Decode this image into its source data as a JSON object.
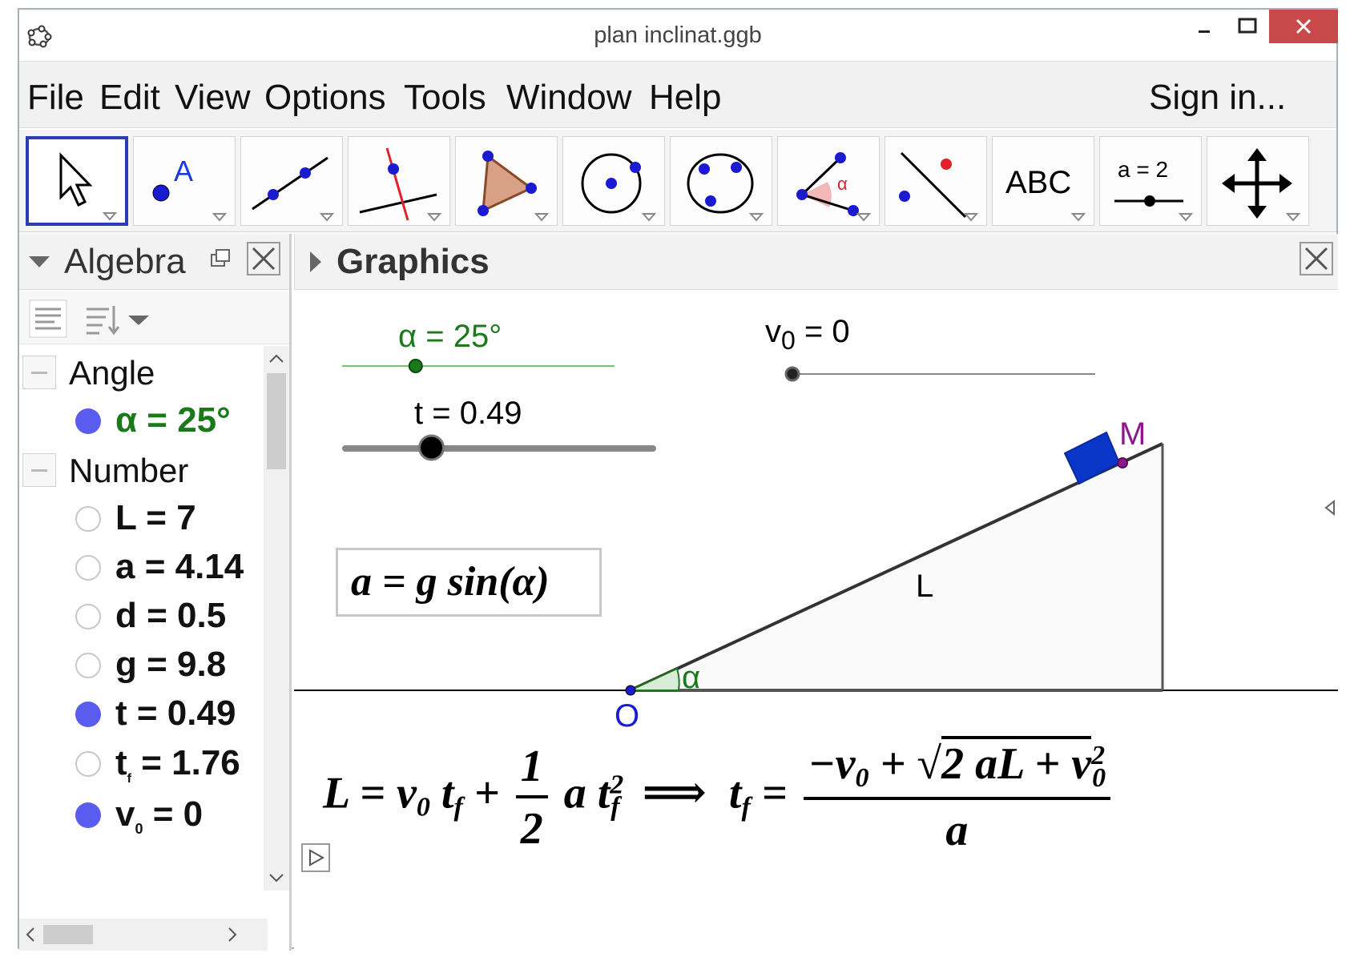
{
  "window": {
    "title": "plan inclinat.ggb"
  },
  "menu": {
    "items": [
      "File",
      "Edit",
      "View",
      "Options",
      "Tools",
      "Window",
      "Help"
    ],
    "sign_in": "Sign in..."
  },
  "toolbar": {
    "tools": [
      {
        "icon": "move-arrow-icon"
      },
      {
        "icon": "point-icon",
        "label": "A"
      },
      {
        "icon": "line-icon"
      },
      {
        "icon": "perpendicular-line-icon"
      },
      {
        "icon": "polygon-icon"
      },
      {
        "icon": "circle-center-point-icon"
      },
      {
        "icon": "circle-three-points-icon"
      },
      {
        "icon": "angle-icon",
        "label": "α"
      },
      {
        "icon": "reflect-about-line-icon"
      },
      {
        "icon": "text-icon",
        "label": "ABC"
      },
      {
        "icon": "slider-icon",
        "label": "a = 2"
      },
      {
        "icon": "move-graphics-view-icon"
      }
    ]
  },
  "algebra": {
    "title": "Algebra",
    "groups": [
      {
        "name": "Angle",
        "items": [
          {
            "text": "α = 25°",
            "visible": true,
            "color": "#1a7a1a"
          }
        ]
      },
      {
        "name": "Number",
        "items": [
          {
            "text": "L = 7",
            "visible": false
          },
          {
            "text": "a = 4.14",
            "visible": false
          },
          {
            "text": "d = 0.5",
            "visible": false
          },
          {
            "text": "g = 9.8",
            "visible": false
          },
          {
            "text": "t = 0.49",
            "visible": true
          },
          {
            "text": "t",
            "sub": "f",
            "rest": " = 1.76",
            "visible": false
          },
          {
            "text": "v",
            "sub": "0",
            "rest": " = 0",
            "visible": true
          }
        ]
      }
    ]
  },
  "graphics": {
    "title": "Graphics",
    "slider_alpha": {
      "label": "α = 25°",
      "value_fraction": 0.27,
      "color": "#1a7a1a"
    },
    "slider_v0": {
      "label_main": "v",
      "label_sub": "0",
      "label_rest": " = 0",
      "value_fraction": 0.0
    },
    "slider_t": {
      "label": "t = 0.49",
      "value_fraction": 0.28
    },
    "formula_a": "a = g sin(α)",
    "labels": {
      "M": "M",
      "O": "O",
      "L": "L",
      "alpha": "α"
    },
    "formula_motion": {
      "lhs": "L = v",
      "sub0": "0",
      "tf_t": "t",
      "tf_f": "f",
      "plus": " + ",
      "half_num": "1",
      "half_den": "2",
      "a": "a",
      "sq": "2",
      "implies": "⟹",
      "neg_v0": "−v",
      "sqrt_body": "2 aL + v",
      "den": "a"
    },
    "colors": {
      "block": "#0a36c8",
      "point_M": "#8a1a8a",
      "point_O": "#1a1ad0",
      "alpha_arc": "#1a7a1a"
    }
  }
}
